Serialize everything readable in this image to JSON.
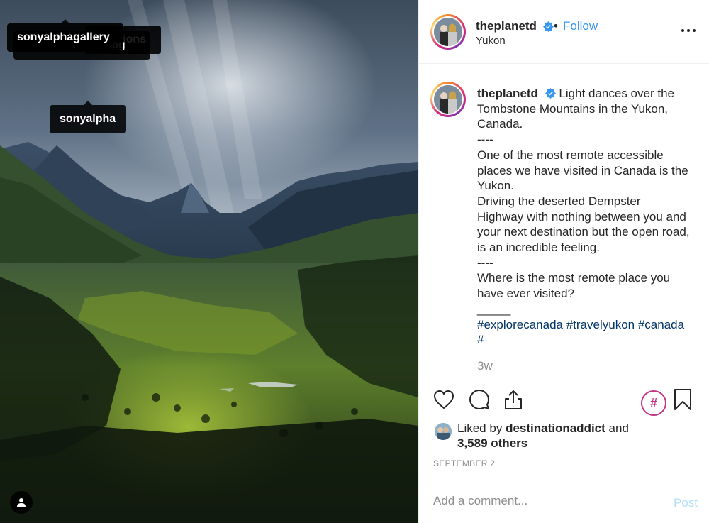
{
  "photo": {
    "tags": {
      "tag_back": "tions",
      "tag_back2": "ag",
      "tag_front": "sonyalphagallery",
      "tag_bottom": "sonyalpha"
    }
  },
  "header": {
    "username": "theplanetd",
    "separator": "•",
    "follow_label": "Follow",
    "location": "Yukon"
  },
  "caption": {
    "username": "theplanetd",
    "lines": [
      "Light dances over the Tombstone Mountains in the Yukon, Canada.",
      "----",
      "One of the most remote accessible places we have visited in Canada is the Yukon.",
      "Driving the deserted Dempster Highway with nothing between you and your next destination but the open road, is an incredible feeling.",
      "----",
      "Where is the most remote place you have ever visited?",
      "_____"
    ],
    "hashtags": [
      "#explorecanada",
      "#travelyukon",
      "#canada",
      "#"
    ],
    "time_ago": "3w"
  },
  "actions": {
    "hashtag_symbol": "#"
  },
  "likes": {
    "prefix": "Liked by",
    "liked_by_user": "destinationaddict",
    "conjunction": "and",
    "others": "3,589 others"
  },
  "date": "SEPTEMBER 2",
  "comment": {
    "placeholder": "Add a comment...",
    "post_label": "Post"
  },
  "colors": {
    "follow": "#3897f0",
    "hashtag": "#003569",
    "post_disabled": "#b2dffc",
    "muted": "#8e8e8e",
    "hashtag_button": "#c13584"
  },
  "icons": [
    "user-tag-icon",
    "verified-badge-icon",
    "more-options-icon",
    "heart-icon",
    "comment-icon",
    "share-icon",
    "hashtag-icon",
    "bookmark-icon"
  ]
}
